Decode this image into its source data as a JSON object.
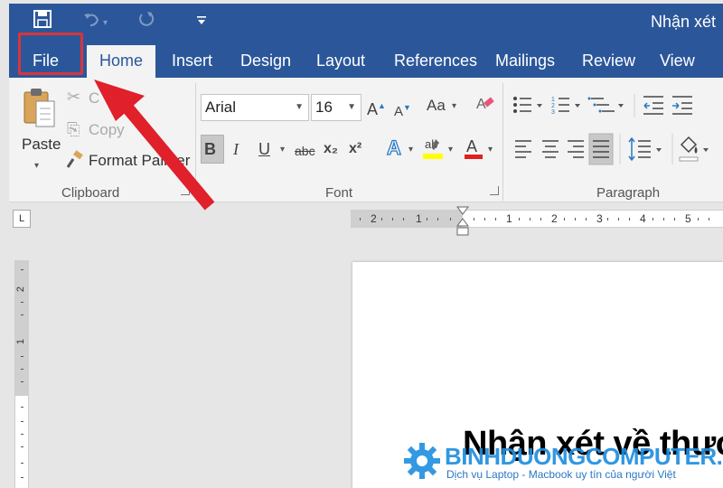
{
  "window": {
    "title": "Nhận xét"
  },
  "quick_access": {
    "save_icon": "save-icon",
    "undo_icon": "undo-icon",
    "redo_icon": "redo-icon",
    "customize_icon": "customize-icon"
  },
  "tabs": [
    {
      "label": "File"
    },
    {
      "label": "Home"
    },
    {
      "label": "Insert"
    },
    {
      "label": "Design"
    },
    {
      "label": "Layout"
    },
    {
      "label": "References"
    },
    {
      "label": "Mailings"
    },
    {
      "label": "Review"
    },
    {
      "label": "View"
    }
  ],
  "clipboard": {
    "paste": "Paste",
    "cut": "C",
    "copy": "Copy",
    "format_painter": "Format Painter",
    "group_label": "Clipboard"
  },
  "font": {
    "name": "Arial",
    "size": "16",
    "change_case": "Aa",
    "bold": "B",
    "italic": "I",
    "underline": "U",
    "strikethrough": "abc",
    "subscript": "x₂",
    "superscript": "x²",
    "font_color": "A",
    "group_label": "Font"
  },
  "paragraph": {
    "group_label": "Paragraph"
  },
  "ruler": {
    "h_numbers_left": [
      "2",
      "1"
    ],
    "h_numbers_right": [
      "1",
      "2",
      "3",
      "4",
      "5"
    ],
    "v_numbers": [
      "2",
      "1"
    ],
    "tab_selector": "L"
  },
  "document": {
    "heading": "Nhận xét về thươ"
  },
  "watermark": {
    "brand": "BINHDUONGCOMPUTER.VN",
    "tagline": "Dịch vụ Laptop - Macbook uy tín của người Việt"
  },
  "colors": {
    "ribbon_blue": "#2b579a",
    "highlight_red": "#d9343b",
    "arrow_red": "#e0202a",
    "watermark_blue": "#1f8fe0"
  }
}
